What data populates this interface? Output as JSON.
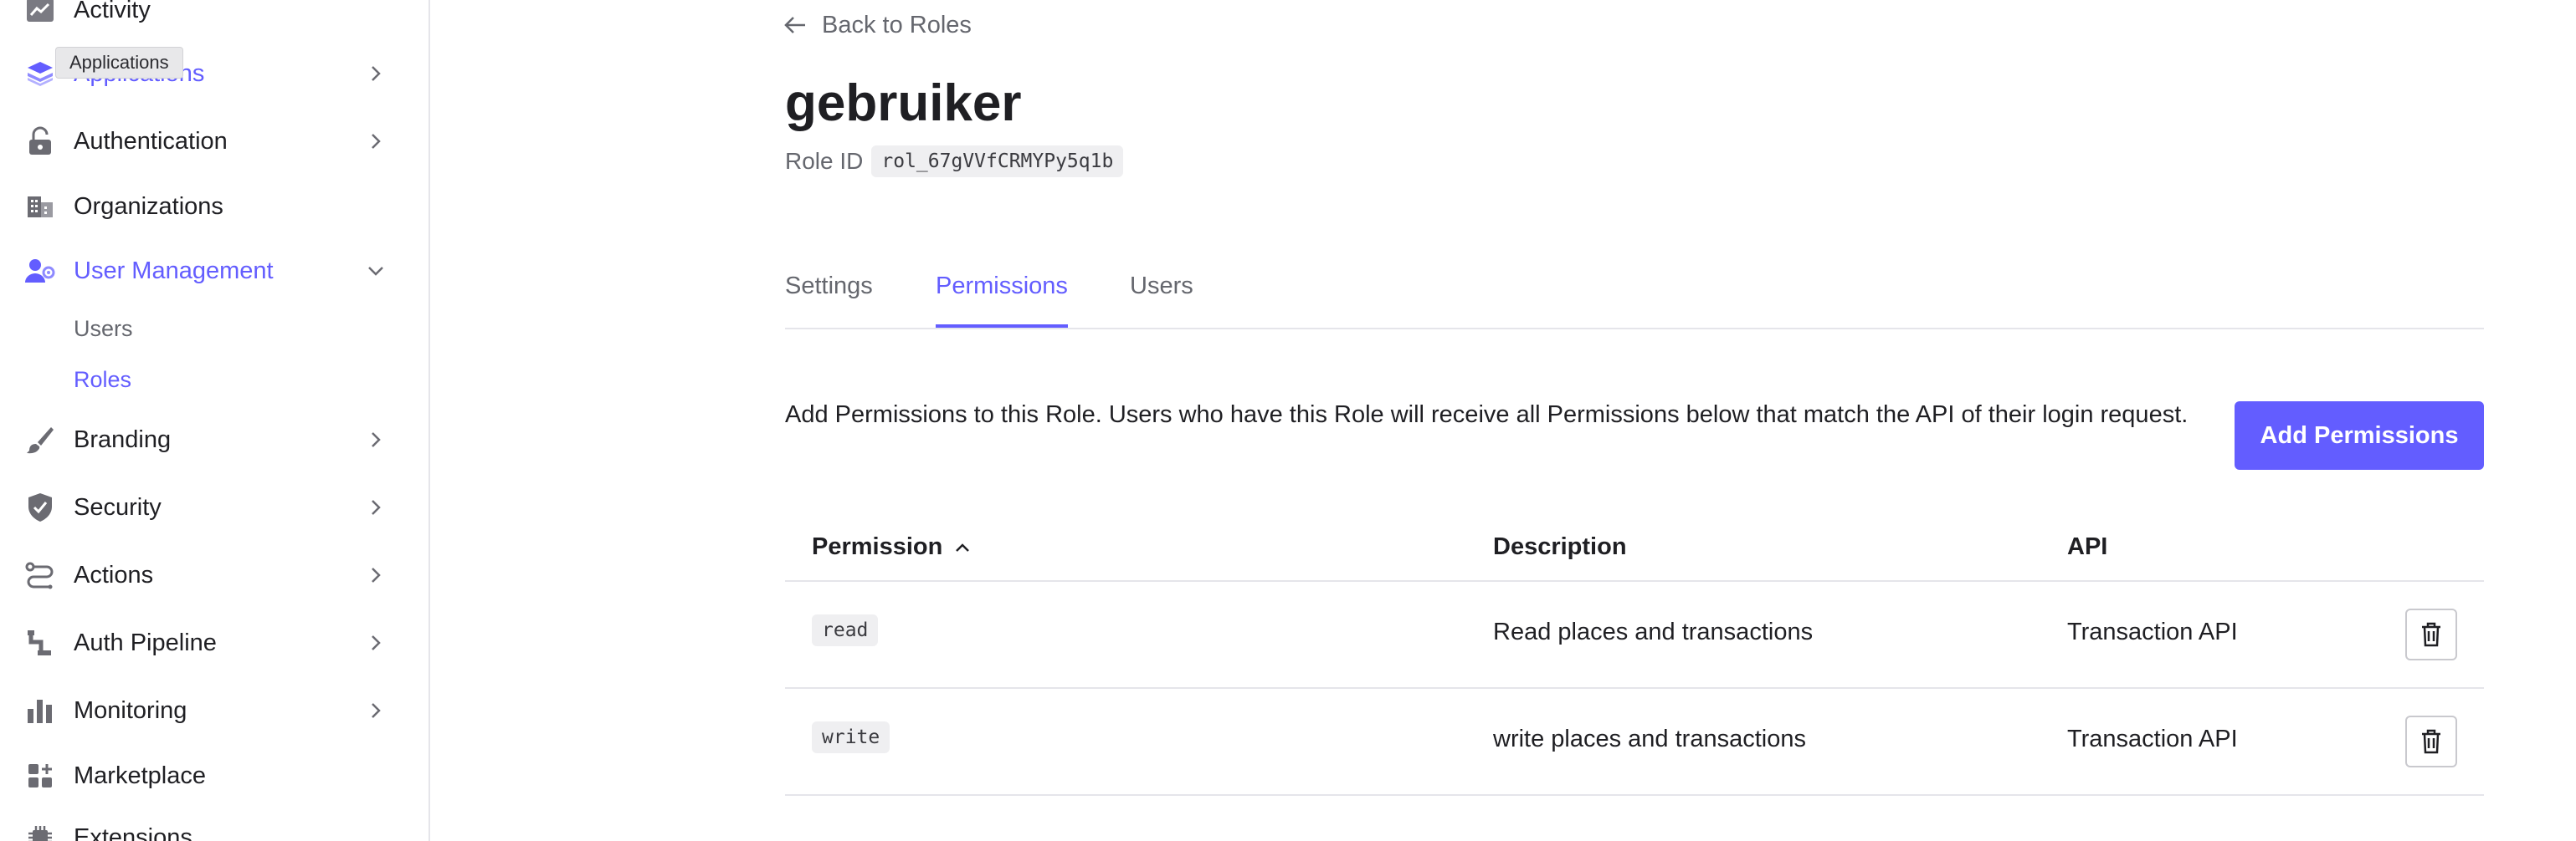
{
  "sidebar": {
    "tooltip": "Applications",
    "items": [
      {
        "label": "Activity",
        "icon": "activity-icon"
      },
      {
        "label": "Applications",
        "icon": "applications-icon"
      },
      {
        "label": "Authentication",
        "icon": "lock-icon"
      },
      {
        "label": "Organizations",
        "icon": "organizations-icon"
      },
      {
        "label": "User Management",
        "icon": "user-management-icon"
      },
      {
        "label": "Branding",
        "icon": "brush-icon"
      },
      {
        "label": "Security",
        "icon": "shield-icon"
      },
      {
        "label": "Actions",
        "icon": "actions-icon"
      },
      {
        "label": "Auth Pipeline",
        "icon": "pipeline-icon"
      },
      {
        "label": "Monitoring",
        "icon": "bar-chart-icon"
      },
      {
        "label": "Marketplace",
        "icon": "marketplace-icon"
      },
      {
        "label": "Extensions",
        "icon": "extensions-icon"
      }
    ],
    "sub_items": [
      {
        "label": "Users"
      },
      {
        "label": "Roles"
      }
    ]
  },
  "main": {
    "back_link": "Back to Roles",
    "title": "gebruiker",
    "role_id_label": "Role ID",
    "role_id": "rol_67gVVfCRMYPy5q1b",
    "tabs": [
      {
        "label": "Settings"
      },
      {
        "label": "Permissions"
      },
      {
        "label": "Users"
      }
    ],
    "description": "Add Permissions to this Role. Users who have this Role will receive all Permissions below that match the API of their login request.",
    "add_button": "Add Permissions",
    "table": {
      "headers": [
        "Permission",
        "Description",
        "API"
      ],
      "rows": [
        {
          "permission": "read",
          "description": "Read places and transactions",
          "api": "Transaction API"
        },
        {
          "permission": "write",
          "description": "write places and transactions",
          "api": "Transaction API"
        }
      ]
    }
  },
  "colors": {
    "accent": "#635dff",
    "text": "#1f1f23",
    "muted": "#65676e",
    "border": "#e5e5ea"
  }
}
